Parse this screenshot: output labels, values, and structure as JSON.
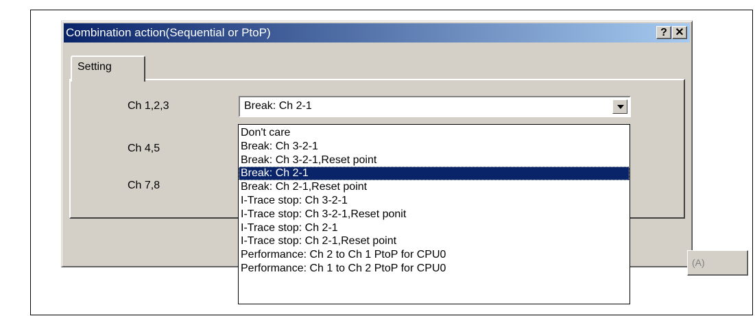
{
  "dialog": {
    "title": "Combination action(Sequential or PtoP)",
    "help_button": "?",
    "close_button": "✕"
  },
  "tabs": [
    {
      "label": "Setting"
    }
  ],
  "rows": [
    {
      "label": "Ch 1,2,3"
    },
    {
      "label": "Ch 4,5"
    },
    {
      "label": "Ch 7,8"
    }
  ],
  "combo": {
    "value": "Break: Ch 2-1"
  },
  "apply_button": {
    "label": "(A)"
  },
  "dropdown": {
    "selected_index": 3,
    "options": [
      "Don't care",
      "Break: Ch 3-2-1",
      "Break: Ch 3-2-1,Reset point",
      "Break: Ch 2-1",
      "Break: Ch 2-1,Reset point",
      "I-Trace stop: Ch 3-2-1",
      "I-Trace stop: Ch 3-2-1,Reset ponit",
      "I-Trace stop: Ch 2-1",
      "I-Trace stop: Ch 2-1,Reset point",
      "Performance: Ch 2 to Ch 1 PtoP for CPU0",
      "Performance: Ch 1 to Ch 2 PtoP for CPU0"
    ]
  }
}
